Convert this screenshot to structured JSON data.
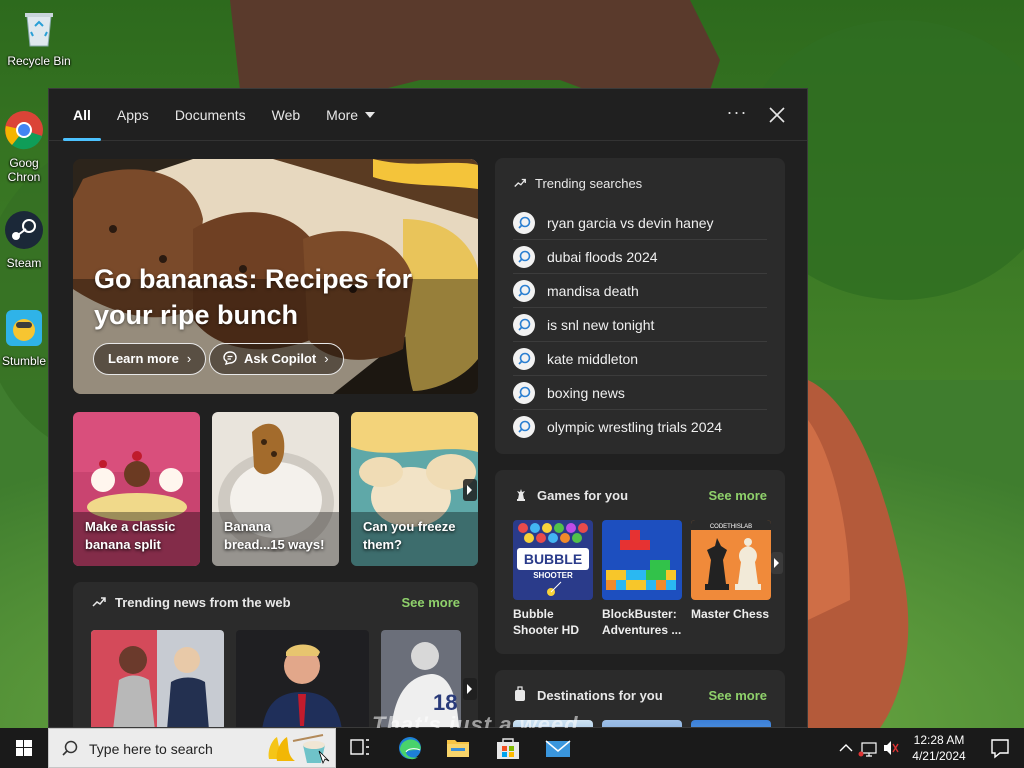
{
  "desktop": {
    "icons": [
      {
        "label": "Recycle Bin"
      },
      {
        "label": "Goog Chron"
      },
      {
        "label": "Steam"
      },
      {
        "label": "Stumble"
      }
    ]
  },
  "search_panel": {
    "tabs": [
      {
        "label": "All",
        "active": true
      },
      {
        "label": "Apps"
      },
      {
        "label": "Documents"
      },
      {
        "label": "Web"
      },
      {
        "label": "More"
      }
    ],
    "hero": {
      "title": "Go bananas: Recipes for your ripe bunch",
      "learn_more": "Learn more",
      "ask_copilot": "Ask Copilot"
    },
    "cards": [
      {
        "caption": "Make a classic banana split"
      },
      {
        "caption": "Banana bread...15 ways!"
      },
      {
        "caption": "Can you freeze them?"
      }
    ],
    "trending_searches": {
      "title": "Trending searches",
      "items": [
        "ryan garcia vs devin haney",
        "dubai floods 2024",
        "mandisa death",
        "is snl new tonight",
        "kate middleton",
        "boxing news",
        "olympic wrestling trials 2024"
      ]
    },
    "trending_news": {
      "title": "Trending news from the web",
      "see_more": "See more"
    },
    "games": {
      "title": "Games for you",
      "see_more": "See more",
      "items": [
        {
          "title": "Bubble Shooter HD"
        },
        {
          "title": "BlockBuster: Adventures ..."
        },
        {
          "title": "Master Chess"
        }
      ]
    },
    "destinations": {
      "title": "Destinations for you",
      "see_more": "See more"
    }
  },
  "taskbar": {
    "search_placeholder": "Type here to search",
    "time": "12:28 AM",
    "date": "4/21/2024"
  },
  "overlay": {
    "subtitle": "That's just a weed."
  },
  "colors": {
    "accent": "#4cc2ff",
    "see_more": "#8fd16b",
    "panel_bg": "#202020",
    "box_bg": "#2b2b2b"
  }
}
